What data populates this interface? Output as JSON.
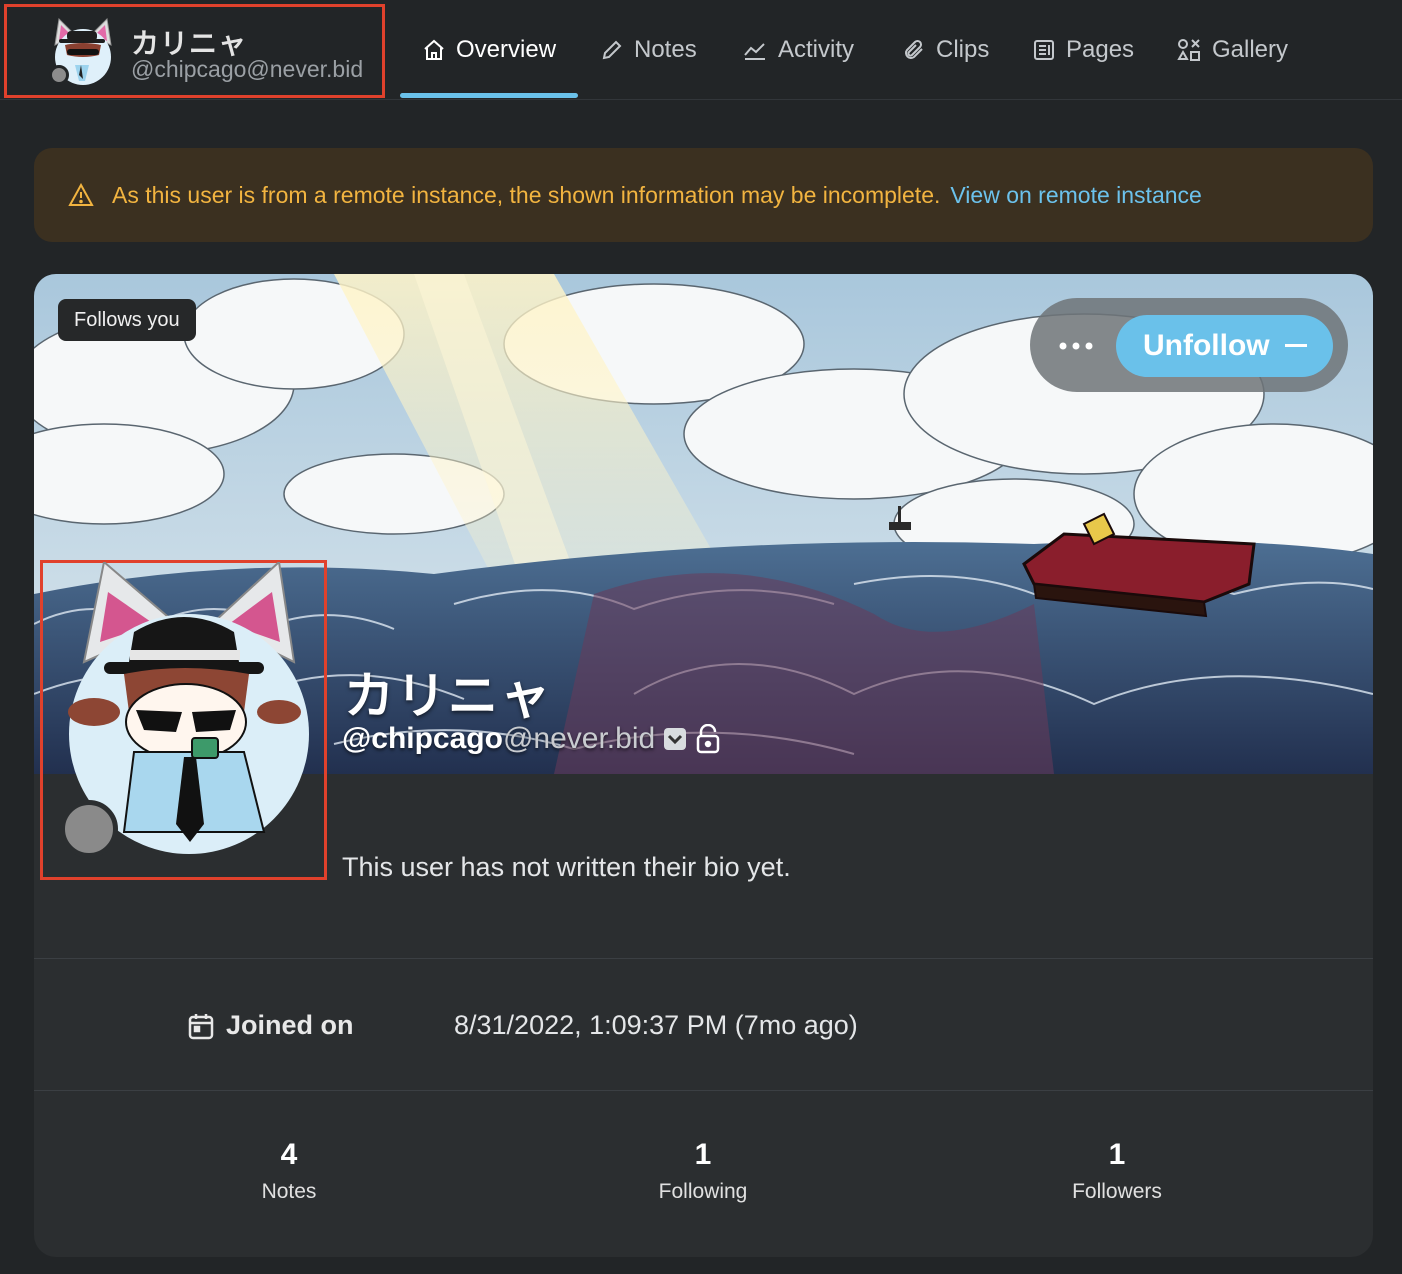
{
  "header": {
    "display_name": "カリニャ",
    "handle": "@chipcago@never.bid",
    "tabs": [
      {
        "label": "Overview",
        "icon": "home-icon",
        "active": true
      },
      {
        "label": "Notes",
        "icon": "pencil-icon"
      },
      {
        "label": "Activity",
        "icon": "chart-line-icon"
      },
      {
        "label": "Clips",
        "icon": "paperclip-icon"
      },
      {
        "label": "Pages",
        "icon": "pages-icon"
      },
      {
        "label": "Gallery",
        "icon": "gallery-icon"
      }
    ]
  },
  "warning": {
    "icon": "alert-triangle-icon",
    "text": "As this user is from a remote instance, the shown information may be incomplete.",
    "link": "View on remote instance"
  },
  "profile": {
    "follows_you": "Follows you",
    "unfollow_label": "Unfollow",
    "name": "カリニャ",
    "handle_user": "@chipcago",
    "handle_host": "@never.bid",
    "bio": "This user has not written their bio yet.",
    "joined_label": "Joined on",
    "joined_value": "8/31/2022, 1:09:37 PM (7mo ago)",
    "stats": [
      {
        "value": "4",
        "label": "Notes"
      },
      {
        "value": "1",
        "label": "Following"
      },
      {
        "value": "1",
        "label": "Followers"
      }
    ]
  },
  "colors": {
    "accent": "#6ac1ea",
    "warning_text": "#f2b440",
    "highlight_frame": "#e0412c",
    "background": "#222527",
    "card": "#2b2e30"
  }
}
